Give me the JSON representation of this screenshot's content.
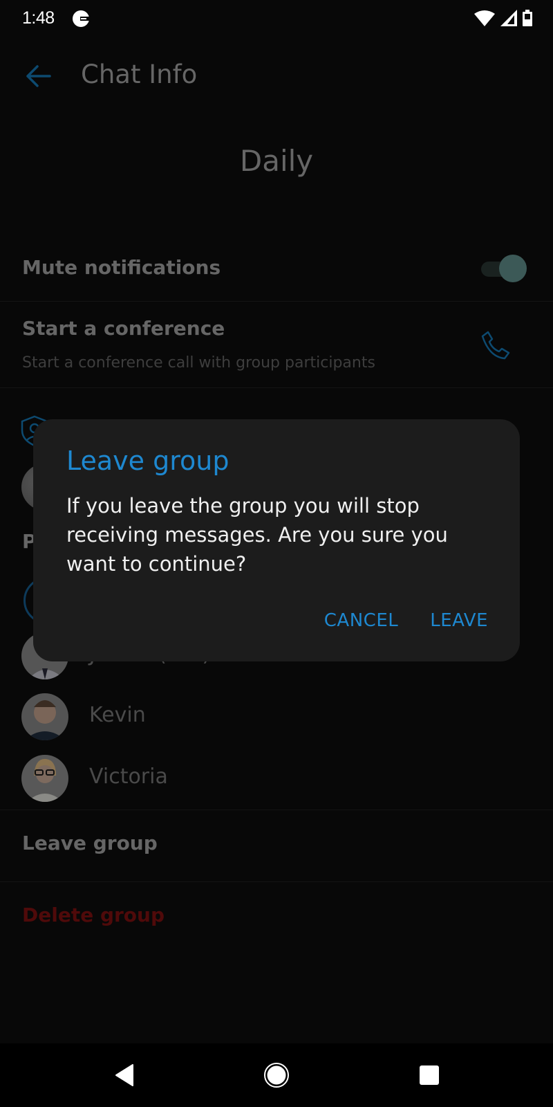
{
  "status_bar": {
    "time": "1:48",
    "icons": [
      "g-app-icon",
      "wifi-icon",
      "signal-icon",
      "battery-icon"
    ]
  },
  "app_bar": {
    "title": "Chat Info",
    "back_icon": "arrow-left-icon"
  },
  "group": {
    "name": "Daily"
  },
  "settings": {
    "mute_label": "Mute notifications",
    "mute_enabled": true,
    "conference_label": "Start a conference",
    "conference_subtitle": "Start a conference call with group participants",
    "conference_icon": "phone-icon"
  },
  "admins": {
    "icon": "shield-icon"
  },
  "participants": {
    "header_partial": "P",
    "members": [
      {
        "name": "James (You)"
      },
      {
        "name": "Kevin"
      },
      {
        "name": "Victoria"
      }
    ]
  },
  "actions": {
    "leave_label": "Leave group",
    "delete_label": "Delete group"
  },
  "dialog": {
    "title": "Leave group",
    "message": "If you leave the group you will stop receiving messages. Are you sure you want to continue?",
    "cancel_label": "CANCEL",
    "confirm_label": "LEAVE"
  },
  "colors": {
    "accent": "#1e88d0",
    "danger": "#c62828",
    "dialog_bg": "#1c1c1c"
  },
  "nav_bar": {
    "back": "nav-back-icon",
    "home": "nav-home-icon",
    "recents": "nav-recents-icon"
  }
}
